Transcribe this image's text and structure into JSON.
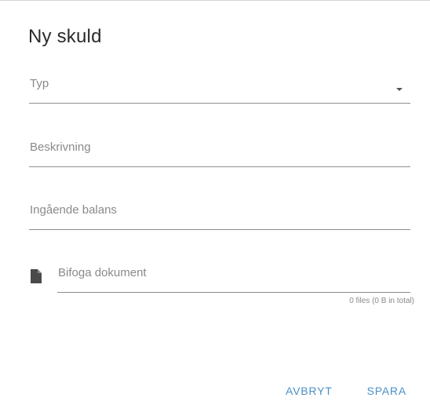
{
  "dialog": {
    "title": "Ny skuld"
  },
  "fields": {
    "typ": {
      "label": "Typ"
    },
    "beskrivning": {
      "label": "Beskrivning"
    },
    "balans": {
      "label": "Ingående balans"
    },
    "attachment": {
      "label": "Bifoga dokument",
      "hint": "0 files (0 B in total)"
    }
  },
  "actions": {
    "cancel": "AVBRYT",
    "save": "SPARA"
  },
  "colors": {
    "accent": "#4a90c8",
    "text": "#2b2b2b",
    "muted": "#8a8a8a"
  },
  "icons": {
    "typ_dropdown": "chevron-down-icon",
    "attachment": "file-icon"
  }
}
